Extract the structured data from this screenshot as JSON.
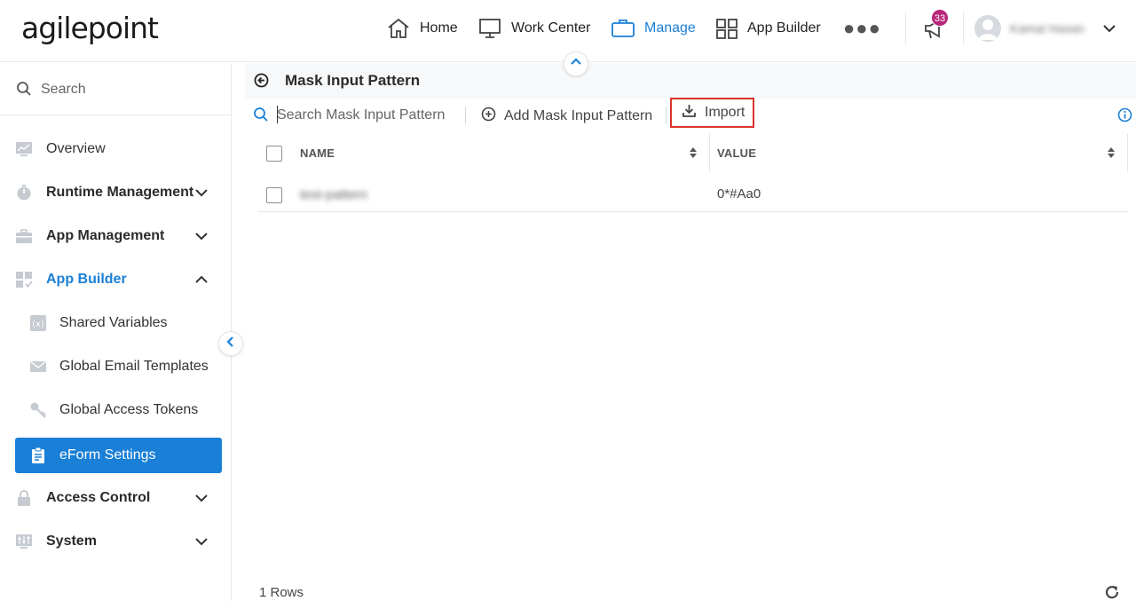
{
  "app": {
    "logo_text": "agilepoint"
  },
  "topnav": {
    "items": [
      {
        "label": "Home",
        "icon": "home-icon"
      },
      {
        "label": "Work Center",
        "icon": "monitor-icon"
      },
      {
        "label": "Manage",
        "icon": "briefcase-icon",
        "active": true
      },
      {
        "label": "App Builder",
        "icon": "grid-icon"
      }
    ],
    "more_icon": "more-dots-icon",
    "notification_count": "33",
    "username": "Kamal Hasan",
    "accent_color": "#1a7fd6",
    "badge_color": "#b8267a"
  },
  "sidebar": {
    "search_placeholder": "Search",
    "items": [
      {
        "label": "Overview",
        "icon": "chart-icon"
      },
      {
        "label": "Runtime Management",
        "icon": "stopwatch-icon",
        "expandable": true
      },
      {
        "label": "App Management",
        "icon": "toolbox-icon",
        "expandable": true
      },
      {
        "label": "App Builder",
        "icon": "app-builder-icon",
        "expanded": true
      },
      {
        "label": "Shared Variables",
        "icon": "variable-icon"
      },
      {
        "label": "Global Email Templates",
        "icon": "envelope-icon"
      },
      {
        "label": "Global Access Tokens",
        "icon": "key-icon"
      },
      {
        "label": "eForm Settings",
        "icon": "clipboard-icon",
        "active": true
      },
      {
        "label": "Access Control",
        "icon": "lock-icon",
        "expandable": true
      },
      {
        "label": "System",
        "icon": "sliders-icon",
        "expandable": true
      }
    ]
  },
  "page": {
    "title": "Mask Input Pattern",
    "search_placeholder": "Search Mask Input Pattern",
    "add_label": "Add Mask Input Pattern",
    "import_label": "Import",
    "columns": [
      "NAME",
      "VALUE"
    ],
    "rows": [
      {
        "name": "test-pattern",
        "value": "0*#Aa0"
      }
    ],
    "rows_count": "1 Rows",
    "highlight_color": "#d8352c"
  }
}
